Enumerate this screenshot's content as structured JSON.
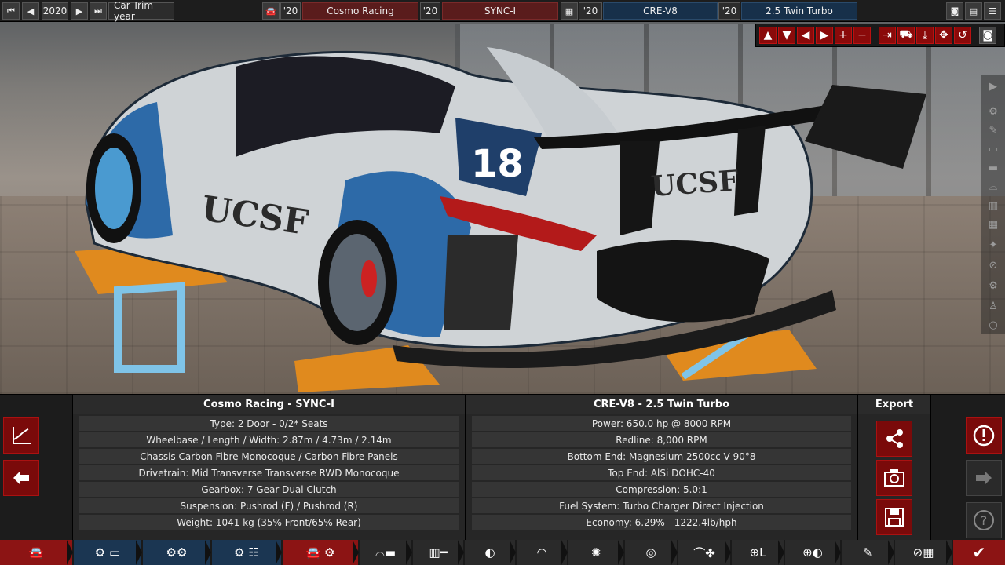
{
  "topbar": {
    "year_nav": {
      "first_icon": "double-left-icon",
      "prev_icon": "left-icon",
      "year": "2020",
      "next_icon": "right-icon",
      "last_icon": "double-right-icon",
      "label": "Car Trim year"
    },
    "car": {
      "model_icon": "car-icon",
      "model_year": "'20",
      "model_name": "Cosmo Racing",
      "trim_year": "'20",
      "trim_name": "SYNC-I"
    },
    "engine": {
      "engine_icon": "engine-icon",
      "family_year": "'20",
      "family_name": "CRE-V8",
      "variant_year": "'20",
      "variant_name": "2.5 Twin Turbo"
    },
    "right_icons": [
      "camera-icon",
      "calculator-icon",
      "menu-icon"
    ]
  },
  "view_tools": [
    "arrow-up-icon",
    "arrow-down-icon",
    "arrow-left-icon",
    "arrow-right-icon",
    "plus-icon",
    "minus-icon",
    "reset-icon",
    "car-view-icon",
    "ground-icon",
    "rotate-icon",
    "undo-icon",
    "screenshot-icon"
  ],
  "rail_icons": [
    "play-icon",
    "wheel-icon",
    "paint-icon",
    "body-icon",
    "panel-icon",
    "roof-icon",
    "grille-icon",
    "frame-icon",
    "brake-icon",
    "gear-icon",
    "person-icon",
    "circle-icon"
  ],
  "car_panel": {
    "title": "Cosmo Racing - SYNC-I",
    "rows": [
      "Type: 2 Door - 0/2* Seats",
      "Wheelbase / Length / Width: 2.87m / 4.73m / 2.14m",
      "Chassis Carbon Fibre Monocoque / Carbon Fibre Panels",
      "Drivetrain: Mid Transverse Transverse RWD Monocoque",
      "Gearbox: 7 Gear Dual Clutch",
      "Suspension: Pushrod (F) / Pushrod (R)",
      "Weight: 1041 kg (35% Front/65% Rear)"
    ]
  },
  "engine_panel": {
    "title": "CRE-V8 - 2.5 Twin Turbo",
    "rows": [
      "Power: 650.0 hp @ 8000 RPM",
      "Redline:  8,000 RPM",
      "Bottom End: Magnesium 2500cc V 90°8",
      "Top End: AlSi DOHC-40",
      "Compression: 5.0:1",
      "Fuel System: Turbo Charger Direct Injection",
      "Economy: 6.29% - 1222.4lb/hph"
    ]
  },
  "export": {
    "title": "Export",
    "buttons": [
      "share-icon",
      "camera-icon",
      "save-icon"
    ]
  },
  "left_buttons": [
    "graph-icon",
    "back-arrow-icon"
  ],
  "right_buttons": [
    "warning-icon",
    "forward-arrow-icon",
    "help-icon"
  ],
  "bottom_nav": [
    "car-body-icon",
    "engine-folder-icon",
    "engine-parts-icon",
    "engine-config-icon",
    "car-engine-icon",
    "car-seats-icon",
    "gearbox-icon",
    "headlight-icon",
    "speedometer-icon",
    "wheel-icon",
    "brake-disc-icon",
    "aero-icon",
    "steering-icon",
    "tyre-icon",
    "paint-icon",
    "finish-flag-icon",
    "confirm-check-icon"
  ]
}
